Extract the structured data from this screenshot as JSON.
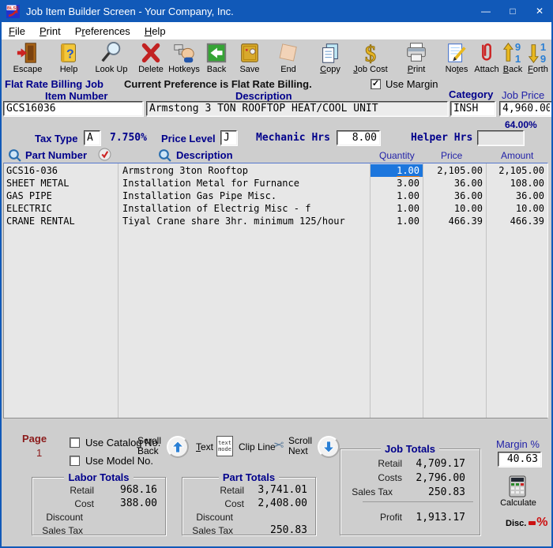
{
  "colors": {
    "titlebar": "#1159b8",
    "navy_label": "#00008b",
    "selection_blue": "#1c76dd",
    "caret_orange": "#e07818",
    "page_red": "#8b1a1a"
  },
  "titlebar": {
    "title": "Job Item Builder Screen - Your Company, Inc.",
    "icon_text": "BLSS",
    "minimize": "—",
    "maximize": "□",
    "close": "✕"
  },
  "menu": {
    "items": [
      {
        "pre": "",
        "u": "F",
        "post": "ile"
      },
      {
        "pre": "",
        "u": "P",
        "post": "rint"
      },
      {
        "pre": "P",
        "u": "r",
        "post": "eferences"
      },
      {
        "pre": "",
        "u": "H",
        "post": "elp"
      }
    ]
  },
  "toolbar": {
    "items": [
      {
        "id": "escape",
        "pre": "Escape",
        "u": "",
        "post": ""
      },
      {
        "id": "help",
        "pre": "Help",
        "u": "",
        "post": ""
      },
      {
        "id": "lookup",
        "pre": "Look Up",
        "u": "",
        "post": ""
      },
      {
        "id": "delete",
        "pre": "Delete",
        "u": "",
        "post": ""
      },
      {
        "id": "hotkeys",
        "pre": "Hotkeys",
        "u": "",
        "post": ""
      },
      {
        "id": "back",
        "pre": "Back",
        "u": "",
        "post": ""
      },
      {
        "id": "save",
        "pre": "Save",
        "u": "",
        "post": ""
      },
      {
        "id": "end",
        "pre": "End",
        "u": "",
        "post": ""
      },
      {
        "id": "copy",
        "pre": "",
        "u": "C",
        "post": "opy"
      },
      {
        "id": "job-cost",
        "pre": "",
        "u": "J",
        "post": "ob Cost"
      },
      {
        "id": "print",
        "pre": "",
        "u": "P",
        "post": "rint"
      },
      {
        "id": "notes",
        "pre": "No",
        "u": "t",
        "post": "es"
      },
      {
        "id": "attach",
        "pre": "Attach",
        "u": "",
        "post": ""
      },
      {
        "id": "back-page",
        "pre": "",
        "u": "B",
        "post": "ack"
      },
      {
        "id": "forth",
        "pre": "",
        "u": "F",
        "post": "orth"
      }
    ]
  },
  "header": {
    "mode_label": "Flat Rate Billing Job",
    "preference_text": "Current Preference is Flat Rate Billing.",
    "use_margin_label": "Use Margin",
    "use_margin_check": "✓",
    "item_number_label": "Item Number",
    "item_number_value": "GCS16036",
    "description_label": "Description",
    "description_value": "Armstong 3 TON ROOFTOP HEAT/COOL UNIT",
    "category_label": "Category",
    "category_value": "INSH",
    "job_price_label": "Job Price",
    "job_price_value": "4,960.00",
    "margin_pct": "64.00%",
    "tax_type_label": "Tax Type",
    "tax_type_value": "A",
    "tax_rate": "7.750%",
    "price_level_label": "Price Level",
    "price_level_value": "J",
    "mechanic_hrs_label": "Mechanic Hrs",
    "mechanic_hrs_value": "8.00",
    "helper_hrs_label": "Helper Hrs",
    "helper_hrs_value": ""
  },
  "parts_table": {
    "columns": {
      "part": "Part Number",
      "desc": "Description",
      "qty": "Quantity",
      "price": "Price",
      "amount": "Amount"
    },
    "rows": [
      {
        "part": "GCS16-036",
        "desc": "Armstrong 3ton Rooftop",
        "qty": "1.00",
        "price": "2,105.00",
        "amount": "2,105.00"
      },
      {
        "part": "SHEET METAL",
        "desc": "Installation Metal for Furnance",
        "qty": "3.00",
        "price": "36.00",
        "amount": "108.00"
      },
      {
        "part": "GAS PIPE",
        "desc": "Installation Gas Pipe Misc.",
        "qty": "1.00",
        "price": "36.00",
        "amount": "36.00"
      },
      {
        "part": "ELECTRIC",
        "desc": "Installation of Electrig Misc - f",
        "qty": "1.00",
        "price": "10.00",
        "amount": "10.00"
      },
      {
        "part": "CRANE RENTAL",
        "desc": "Tiyal Crane share 3hr. minimum 125/hour",
        "qty": "1.00",
        "price": "466.39",
        "amount": "466.39"
      }
    ]
  },
  "footer": {
    "page_label": "Page",
    "page_number": "1",
    "use_catalog_label": "Use Catalog No.",
    "use_model_label": "Use Model No.",
    "scroll_back": {
      "line1": "Scroll",
      "line2": "Back"
    },
    "text_button": {
      "pre": "",
      "u": "T",
      "post": "ext"
    },
    "text_mode_icon": {
      "line1": "text",
      "line2": "mode"
    },
    "clip_line_label": "Clip Line",
    "scissors_glyph": "✂",
    "scroll_next": {
      "line1": "Scroll",
      "line2": "Next"
    },
    "labor_totals": {
      "title": "Labor Totals",
      "rows": [
        {
          "label": "Retail",
          "value": "968.16"
        },
        {
          "label": "Cost",
          "value": "388.00"
        },
        {
          "label": "Discount",
          "value": ""
        },
        {
          "label": "Sales Tax",
          "value": ""
        }
      ]
    },
    "part_totals": {
      "title": "Part Totals",
      "rows": [
        {
          "label": "Retail",
          "value": "3,741.01"
        },
        {
          "label": "Cost",
          "value": "2,408.00"
        },
        {
          "label": "Discount",
          "value": ""
        },
        {
          "label": "Sales Tax",
          "value": "250.83"
        }
      ]
    },
    "job_totals": {
      "title": "Job Totals",
      "rows": [
        {
          "label": "Retail",
          "value": "4,709.17"
        },
        {
          "label": "Costs",
          "value": "2,796.00"
        },
        {
          "label": "Sales Tax",
          "value": "250.83"
        }
      ],
      "profit_label": "Profit",
      "profit_value": "1,913.17"
    },
    "margin": {
      "label": "Margin %",
      "value": "40.63"
    },
    "calculate_label": "Calculate",
    "disc_label": "Disc.",
    "disc_symbol": "%"
  }
}
